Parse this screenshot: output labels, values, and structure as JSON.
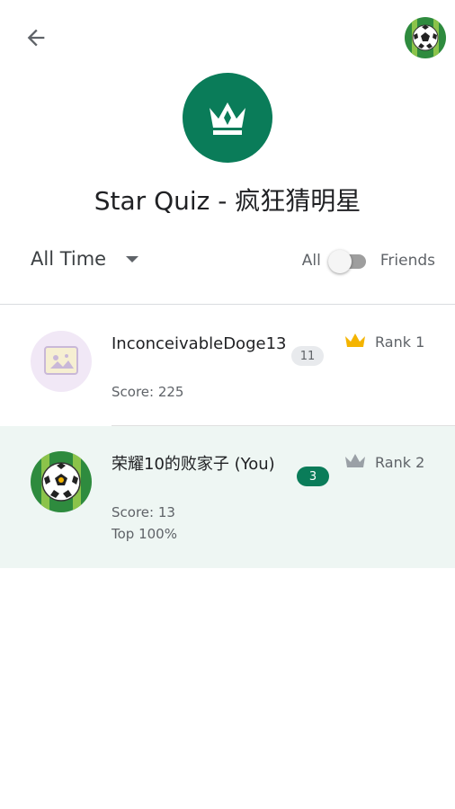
{
  "header": {
    "title": "Star Quiz - 疯狂猜明星",
    "back_icon": "arrow-back-icon",
    "profile_icon": "soccer-ball-avatar",
    "leaderboard_icon": "crown-icon"
  },
  "filters": {
    "time_range": "All Time",
    "toggle_left": "All",
    "toggle_right": "Friends",
    "toggle_on": false
  },
  "leaderboard": [
    {
      "name": "InconceivableDoge13",
      "score": "Score: 225",
      "level": "11",
      "rank": "Rank 1",
      "crown_color": "#f4b400",
      "avatar": "doge-avatar",
      "is_you": false
    },
    {
      "name": "荣耀10的败家子 (You)",
      "score": "Score: 13",
      "top": "Top 100%",
      "level": "3",
      "rank": "Rank 2",
      "crown_color": "#9aa0a6",
      "avatar": "soccer-ball-avatar",
      "is_you": true
    }
  ],
  "colors": {
    "accent": "#0a7c59",
    "highlight_row": "#eef6f3"
  }
}
